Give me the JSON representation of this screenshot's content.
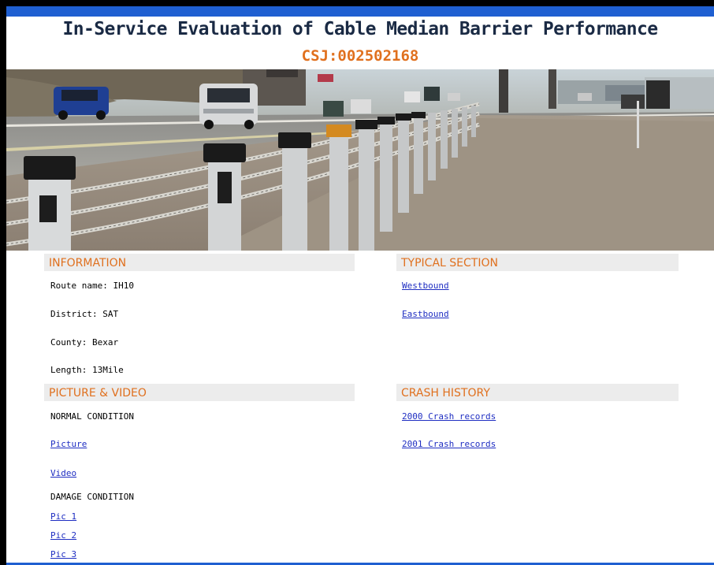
{
  "header": {
    "title": "In-Service Evaluation of Cable Median Barrier Performance",
    "subtitle": "CSJ:002502168"
  },
  "information": {
    "heading": "INFORMATION",
    "route": "Route name: IH10",
    "district": "District: SAT",
    "county": "County: Bexar",
    "length": "Length: 13Mile"
  },
  "typical_section": {
    "heading": "TYPICAL SECTION",
    "links": [
      "Westbound",
      "Eastbound"
    ]
  },
  "picture_video": {
    "heading": "PICTURE & VIDEO",
    "normal_label": "NORMAL CONDITION",
    "normal_links": [
      "Picture",
      "Video"
    ],
    "damage_label": "DAMAGE CONDITION",
    "damage_links": [
      "Pic 1",
      "Pic 2",
      "Pic 3"
    ]
  },
  "crash_history": {
    "heading": "CRASH HISTORY",
    "links": [
      "2000 Crash records",
      "2001 Crash records"
    ]
  },
  "colors": {
    "accent": "#e0701e",
    "link": "#1f2ec2",
    "band": "#1f5fd1",
    "header_bg": "#ececec"
  }
}
